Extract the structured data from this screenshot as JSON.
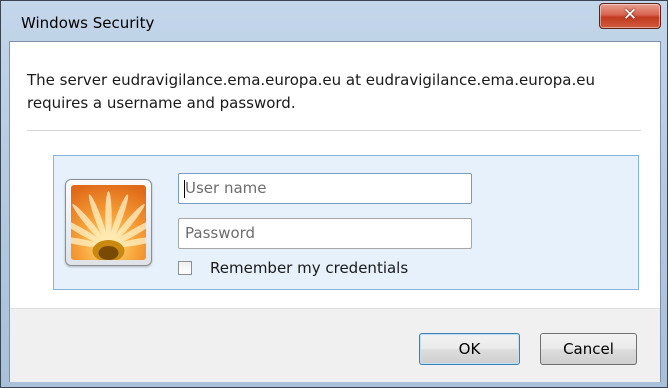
{
  "window": {
    "title": "Windows Security",
    "close_symbol": "✕"
  },
  "dialog": {
    "message_line1": "The server eudravigilance.ema.europa.eu at eudravigilance.ema.europa.eu",
    "message_line2": "requires a username and password."
  },
  "credentials": {
    "user_tile_icon": "orange-flower-user-tile",
    "username_placeholder": "User name",
    "username_value": "",
    "password_placeholder": "Password",
    "password_value": "",
    "remember_label": "Remember my credentials",
    "remember_checked": false
  },
  "buttons": {
    "ok_label": "OK",
    "cancel_label": "Cancel"
  }
}
